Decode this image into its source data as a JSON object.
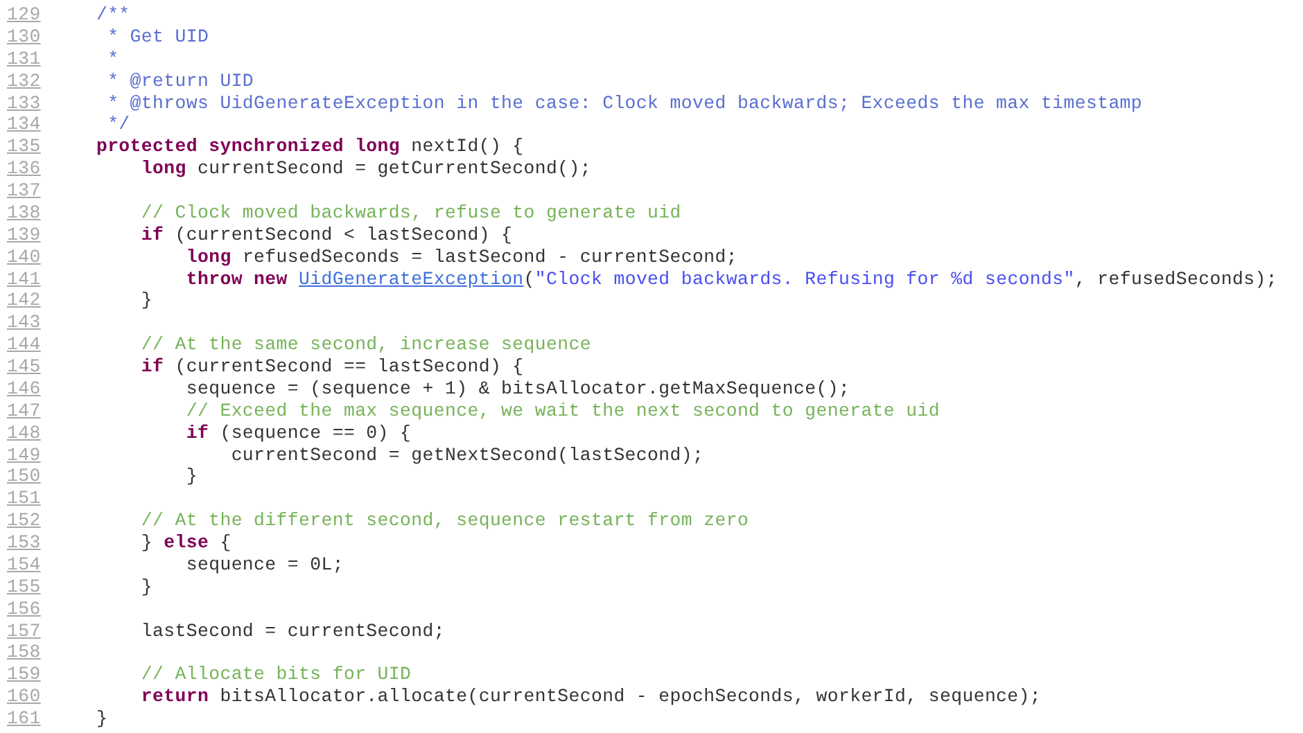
{
  "lines": [
    {
      "number": "129",
      "tokens": [
        {
          "kind": "doc",
          "text": "    /**"
        }
      ]
    },
    {
      "number": "130",
      "tokens": [
        {
          "kind": "doc",
          "text": "     * Get UID"
        }
      ]
    },
    {
      "number": "131",
      "tokens": [
        {
          "kind": "doc",
          "text": "     *"
        }
      ]
    },
    {
      "number": "132",
      "tokens": [
        {
          "kind": "doc",
          "text": "     * @return UID"
        }
      ]
    },
    {
      "number": "133",
      "tokens": [
        {
          "kind": "doc",
          "text": "     * @throws UidGenerateException in the case: Clock moved backwards; Exceeds the max timestamp"
        }
      ]
    },
    {
      "number": "134",
      "tokens": [
        {
          "kind": "doc",
          "text": "     */"
        }
      ]
    },
    {
      "number": "135",
      "tokens": [
        {
          "kind": "keyword",
          "text": "    protected synchronized long"
        },
        {
          "kind": "plain",
          "text": " nextId() {"
        }
      ]
    },
    {
      "number": "136",
      "tokens": [
        {
          "kind": "keyword",
          "text": "        long"
        },
        {
          "kind": "plain",
          "text": " currentSecond = getCurrentSecond();"
        }
      ]
    },
    {
      "number": "137"
    },
    {
      "number": "138",
      "tokens": [
        {
          "kind": "comment",
          "text": "        // Clock moved backwards, refuse to generate uid"
        }
      ]
    },
    {
      "number": "139",
      "tokens": [
        {
          "kind": "keyword",
          "text": "        if"
        },
        {
          "kind": "plain",
          "text": " (currentSecond < lastSecond) {"
        }
      ]
    },
    {
      "number": "140",
      "tokens": [
        {
          "kind": "keyword",
          "text": "            long"
        },
        {
          "kind": "plain",
          "text": " refusedSeconds = lastSecond - currentSecond;"
        }
      ]
    },
    {
      "number": "141",
      "tokens": [
        {
          "kind": "keyword",
          "text": "            throw new "
        },
        {
          "kind": "link",
          "text": "UidGenerateException"
        },
        {
          "kind": "plain",
          "text": "("
        },
        {
          "kind": "string",
          "text": "\"Clock moved backwards. Refusing for %d seconds\""
        },
        {
          "kind": "plain",
          "text": ", refusedSeconds);"
        }
      ]
    },
    {
      "number": "142",
      "tokens": [
        {
          "kind": "plain",
          "text": "        }"
        }
      ]
    },
    {
      "number": "143"
    },
    {
      "number": "144",
      "tokens": [
        {
          "kind": "comment",
          "text": "        // At the same second, increase sequence"
        }
      ]
    },
    {
      "number": "145",
      "tokens": [
        {
          "kind": "keyword",
          "text": "        if"
        },
        {
          "kind": "plain",
          "text": " (currentSecond == lastSecond) {"
        }
      ]
    },
    {
      "number": "146",
      "tokens": [
        {
          "kind": "plain",
          "text": "            sequence = (sequence + 1) & bitsAllocator.getMaxSequence();"
        }
      ]
    },
    {
      "number": "147",
      "tokens": [
        {
          "kind": "comment",
          "text": "            // Exceed the max sequence, we wait the next second to generate uid"
        }
      ]
    },
    {
      "number": "148",
      "tokens": [
        {
          "kind": "keyword",
          "text": "            if"
        },
        {
          "kind": "plain",
          "text": " (sequence == 0) {"
        }
      ]
    },
    {
      "number": "149",
      "tokens": [
        {
          "kind": "plain",
          "text": "                currentSecond = getNextSecond(lastSecond);"
        }
      ]
    },
    {
      "number": "150",
      "tokens": [
        {
          "kind": "plain",
          "text": "            }"
        }
      ]
    },
    {
      "number": "151"
    },
    {
      "number": "152",
      "tokens": [
        {
          "kind": "comment",
          "text": "        // At the different second, sequence restart from zero"
        }
      ]
    },
    {
      "number": "153",
      "tokens": [
        {
          "kind": "plain",
          "text": "        } "
        },
        {
          "kind": "keyword",
          "text": "else"
        },
        {
          "kind": "plain",
          "text": " {"
        }
      ]
    },
    {
      "number": "154",
      "tokens": [
        {
          "kind": "plain",
          "text": "            sequence = 0L;"
        }
      ]
    },
    {
      "number": "155",
      "tokens": [
        {
          "kind": "plain",
          "text": "        }"
        }
      ]
    },
    {
      "number": "156"
    },
    {
      "number": "157",
      "tokens": [
        {
          "kind": "plain",
          "text": "        lastSecond = currentSecond;"
        }
      ]
    },
    {
      "number": "158"
    },
    {
      "number": "159",
      "tokens": [
        {
          "kind": "comment",
          "text": "        // Allocate bits for UID"
        }
      ]
    },
    {
      "number": "160",
      "tokens": [
        {
          "kind": "keyword",
          "text": "        return"
        },
        {
          "kind": "plain",
          "text": " bitsAllocator.allocate(currentSecond - epochSeconds, workerId, sequence);"
        }
      ]
    },
    {
      "number": "161",
      "tokens": [
        {
          "kind": "plain",
          "text": "    }"
        }
      ]
    }
  ]
}
